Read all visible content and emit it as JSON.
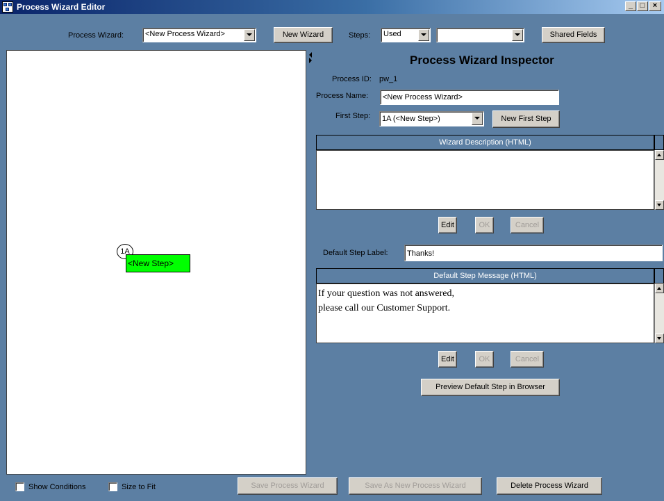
{
  "window": {
    "title": "Process Wizard Editor",
    "minimize": "_",
    "maximize": "□",
    "close": "×"
  },
  "toolbar": {
    "process_wizard_label": "Process Wizard:",
    "process_wizard_value": "<New Process Wizard>",
    "new_wizard_button": "New Wizard",
    "steps_label": "Steps:",
    "steps_value": "Used",
    "steps_filter_value": "",
    "shared_fields_button": "Shared Fields"
  },
  "canvas": {
    "step_id": "1A",
    "step_label": "<New Step>",
    "step_color": "#00ff00"
  },
  "inspector": {
    "title": "Process Wizard Inspector",
    "process_id_label": "Process ID:",
    "process_id_value": "pw_1",
    "process_name_label": "Process Name:",
    "process_name_value": "<New Process Wizard>",
    "first_step_label": "First Step:",
    "first_step_value": "1A (<New Step>)",
    "new_first_step_button": "New First Step",
    "wizard_description_header": "Wizard Description (HTML)",
    "wizard_description_text": "",
    "edit_button": "Edit",
    "ok_button": "OK",
    "cancel_button": "Cancel",
    "default_step_label_label": "Default Step Label:",
    "default_step_label_value": "Thanks!",
    "default_step_message_header": "Default Step Message (HTML)",
    "default_step_message_line1": "If your question was not answered,",
    "default_step_message_line2": "please call our Customer Support.",
    "preview_button": "Preview Default Step in Browser"
  },
  "footer": {
    "show_conditions_label": "Show Conditions",
    "size_to_fit_label": "Size to Fit",
    "save_button": "Save Process Wizard",
    "save_as_new_button": "Save As New Process Wizard",
    "delete_button": "Delete Process Wizard"
  },
  "colors": {
    "background": "#5c7fa3",
    "titlebar_start": "#0a246a",
    "step_fill": "#00ff00"
  }
}
